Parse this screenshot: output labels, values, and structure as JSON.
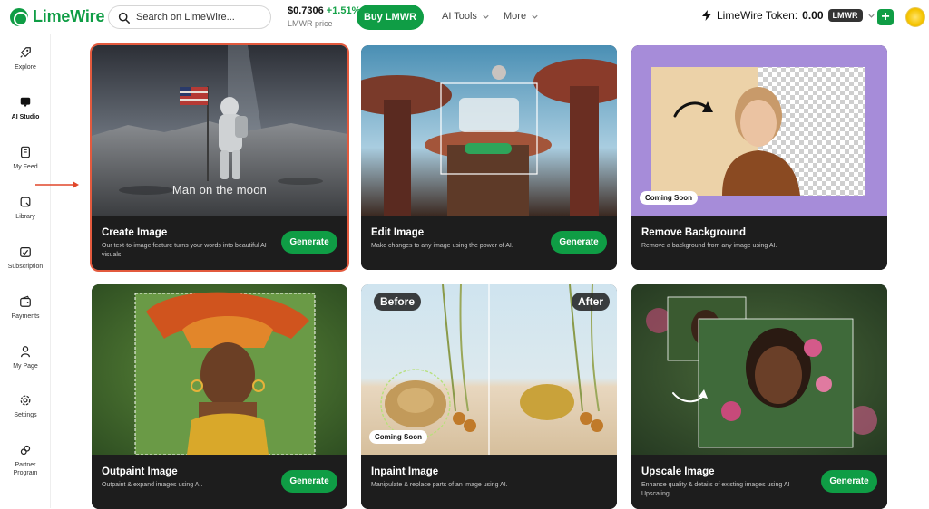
{
  "brand": {
    "name": "LimeWire",
    "color": "#0f9d45"
  },
  "search": {
    "placeholder": "Search on LimeWire..."
  },
  "price": {
    "value": "$0.7306",
    "change": "+1.51%",
    "label": "LMWR price"
  },
  "header": {
    "buy_label": "Buy LMWR",
    "ai_tools_label": "AI Tools",
    "more_label": "More",
    "token_label": "LimeWire Token:",
    "token_value": "0.00",
    "token_symbol": "LMWR",
    "add_label": "+"
  },
  "sidebar": {
    "items": [
      {
        "label": "Explore",
        "icon": "rocket-icon"
      },
      {
        "label": "AI Studio",
        "icon": "chat-icon",
        "active": true
      },
      {
        "label": "My Feed",
        "icon": "feed-icon"
      },
      {
        "label": "Library",
        "icon": "library-icon"
      },
      {
        "label": "Subscription",
        "icon": "subscription-icon"
      },
      {
        "label": "Payments",
        "icon": "wallet-icon"
      },
      {
        "label": "My Page",
        "icon": "user-icon"
      },
      {
        "label": "Settings",
        "icon": "gear-icon"
      },
      {
        "label": "Partner Program",
        "icon": "link-icon"
      }
    ]
  },
  "cards": [
    {
      "title": "Create Image",
      "desc": "Our text-to-image feature turns your words into beautiful AI visuals.",
      "button": "Generate",
      "overlay": "Man on the moon",
      "selected": true
    },
    {
      "title": "Edit Image",
      "desc": "Make changes to any image using the power of AI.",
      "button": "Generate"
    },
    {
      "title": "Remove Background",
      "desc": "Remove a background from any image using AI.",
      "badge": "Coming Soon"
    },
    {
      "title": "Outpaint Image",
      "desc": "Outpaint & expand images using AI.",
      "button": "Generate"
    },
    {
      "title": "Inpaint Image",
      "desc": "Manipulate & replace parts of an image using AI.",
      "badge": "Coming Soon",
      "before": "Before",
      "after": "After"
    },
    {
      "title": "Upscale Image",
      "desc": "Enhance quality & details of existing images using AI Upscaling.",
      "button": "Generate"
    }
  ],
  "colors": {
    "accent": "#0f9d45",
    "selection": "#e35a3e",
    "card_bg": "#1d1d1d"
  }
}
